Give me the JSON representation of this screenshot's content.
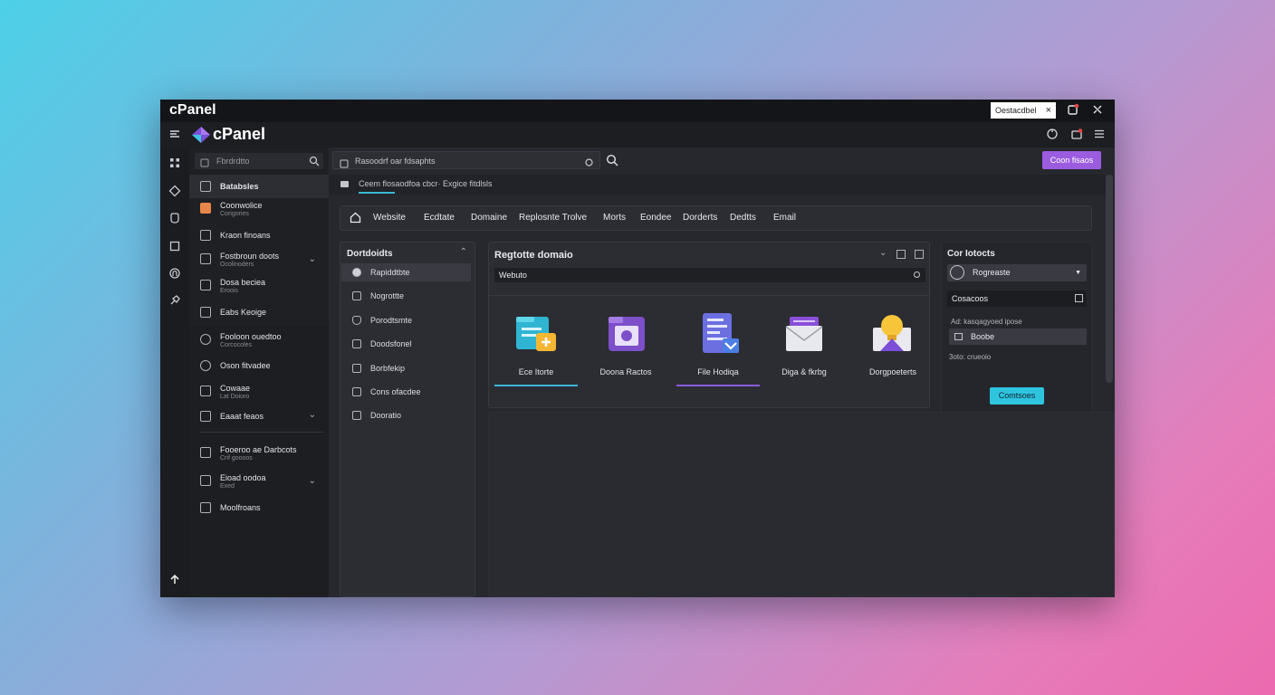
{
  "titlebar": {
    "title": "cPanel",
    "download_label": "Oestacdbel",
    "close_glyph": "×"
  },
  "appbar": {
    "logo_text": "cPanel"
  },
  "sidebar": {
    "search_placeholder": "Fbrdrdtto",
    "items": [
      {
        "label": "Batabsles",
        "sub": ""
      },
      {
        "label": "Coonwolice",
        "sub": "Corigories"
      },
      {
        "label": "Kraon finoans",
        "sub": ""
      },
      {
        "label": "Fostbroun doots",
        "sub": "Ocolinoders"
      },
      {
        "label": "Dosa beciea",
        "sub": "Eroois"
      },
      {
        "label": "Eabs Keoige",
        "sub": ""
      },
      {
        "label": "Fooloon ouedtoo",
        "sub": "Corcocoles"
      },
      {
        "label": "Oson fitvadee",
        "sub": ""
      },
      {
        "label": "Cowaae",
        "sub": "Lat Doioro"
      },
      {
        "label": "Eaaat feaos",
        "sub": ""
      },
      {
        "label": "Fooeroo ae Darbcots",
        "sub": "Crif goooos"
      },
      {
        "label": "Eioad oodoa",
        "sub": "Exed"
      },
      {
        "label": "Moolfroans",
        "sub": ""
      }
    ]
  },
  "main": {
    "search_value": "Rasoodrf oar fdsaphts",
    "action_button": "Coon fisaos",
    "breadcrumb": "Ceem flosaodfoa cbcr·  Exgice fitdlsls",
    "nav": [
      "Website",
      "Ecdtate",
      "Domaine",
      "Replosnte Trolve",
      "Morts",
      "Eondee",
      "Dorderts",
      "Dedtts",
      "Email"
    ],
    "left_panel": {
      "title": "Dortdoidts",
      "items": [
        "Rapiddtbte",
        "Nogrottte",
        "Porodtsmte",
        "Doodsfonel",
        "Borbfekip",
        "Cons ofacdee",
        "Dooratio"
      ]
    },
    "center_panel": {
      "title": "Regtotte domaio",
      "select_value": "Webuto",
      "tiles": [
        {
          "label": "Ece Itorte",
          "icon": "file-manager-icon",
          "underline": "#3ab8d4"
        },
        {
          "label": "Doona Ractos",
          "icon": "purple-folder-icon",
          "underline": ""
        },
        {
          "label": "File Hodiqa",
          "icon": "document-icon",
          "underline": "#8c5cdb"
        },
        {
          "label": "Diga & fkrbg",
          "icon": "email-icon",
          "underline": ""
        },
        {
          "label": "Dorgpoeterts",
          "icon": "lightbulb-box-icon",
          "underline": ""
        }
      ]
    },
    "right_panel": {
      "title": "Cor Iotocts",
      "select_value": "Rogreaste",
      "row1": "Cosacoos",
      "text": "Ad: kasqagyoed ipose",
      "input_value": "Boobe",
      "caption": "3oto: crueoio",
      "button": "Comtsoes"
    }
  },
  "colors": {
    "accent_purple": "#9b5ce0",
    "accent_cyan": "#2ec4de",
    "bg": "#232429"
  }
}
